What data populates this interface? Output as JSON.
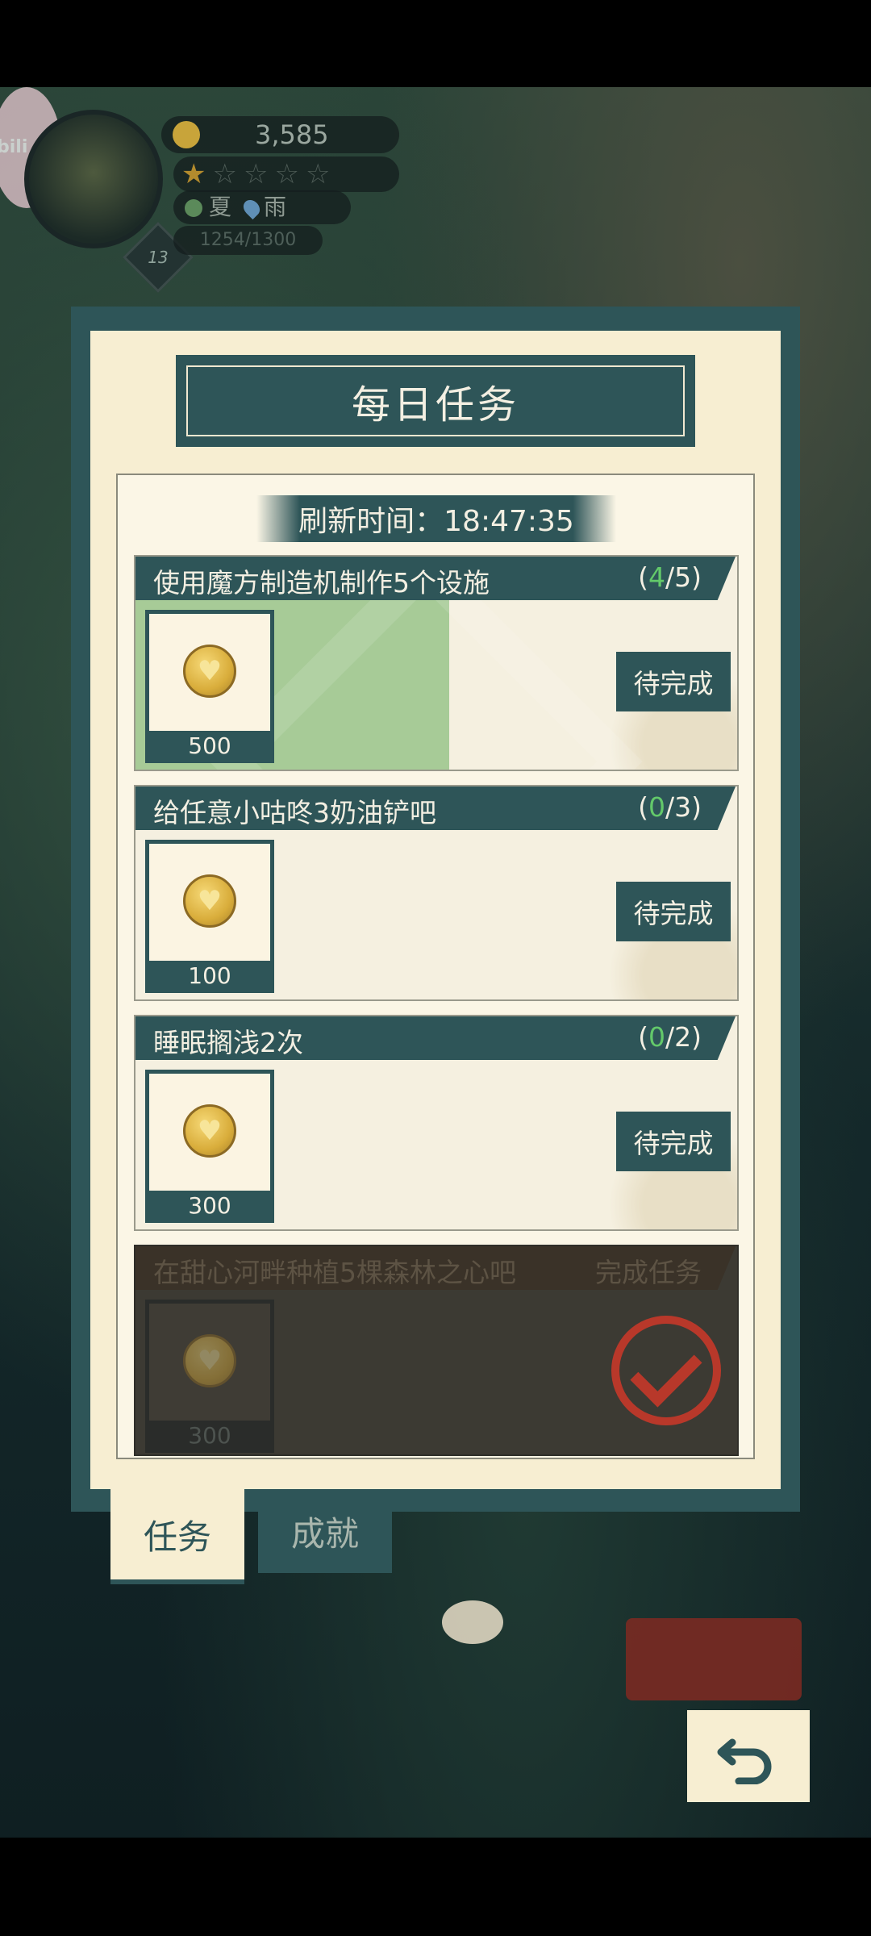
{
  "hud": {
    "badge_text": "bili",
    "coins": "3,585",
    "stars_filled": 1,
    "stars_total": 5,
    "season": "夏",
    "weather": "雨",
    "xp": "1254/1300",
    "level": "13"
  },
  "panel": {
    "title": "每日任务",
    "refresh_label": "刷新时间：18:47:35"
  },
  "tasks": [
    {
      "name": "使用魔方制造机制作5个设施",
      "count_open": "(",
      "current": "4",
      "total_suffix": "/5)",
      "progress": 0.8,
      "reward": "500",
      "status": "待完成"
    },
    {
      "name": "给任意小咕咚3奶油铲吧",
      "count_open": "(",
      "current": "0",
      "total_suffix": "/3)",
      "progress": 0,
      "reward": "100",
      "status": "待完成"
    },
    {
      "name": "睡眠搁浅2次",
      "count_open": "(",
      "current": "0",
      "total_suffix": "/2)",
      "progress": 0,
      "reward": "300",
      "status": "待完成"
    },
    {
      "name": "在甜心河畔种植5棵森林之心吧",
      "status_text": "完成任务",
      "reward": "300",
      "completed": true
    }
  ],
  "tabs": {
    "tasks": "任务",
    "achievements": "成就"
  },
  "colors": {
    "panel_teal": "#2e5558",
    "panel_cream": "#f7eed2",
    "progress_green": "#a7cb97",
    "count_green": "#63c96a",
    "stamp_red": "#b8382a"
  },
  "icons": {
    "coin": "heart-coin-icon",
    "back": "undo-arrow-icon"
  }
}
